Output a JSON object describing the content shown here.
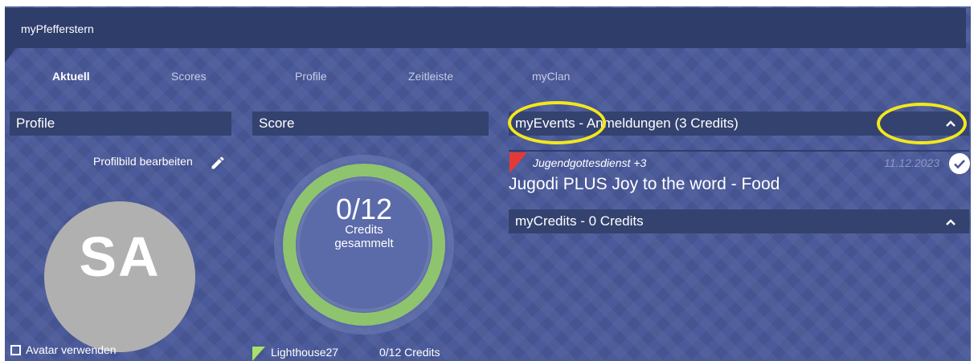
{
  "app": {
    "title": "myPfefferstern"
  },
  "tabs": [
    {
      "label": "Aktuell",
      "active": true
    },
    {
      "label": "Scores"
    },
    {
      "label": "Profile"
    },
    {
      "label": "Zeitleiste"
    },
    {
      "label": "myClan"
    }
  ],
  "profile": {
    "header": "Profile",
    "edit_label": "Profilbild bearbeiten",
    "initials": "SA",
    "avatar_checkbox_label": "Avatar verwenden",
    "avatar_checkbox_checked": false
  },
  "score": {
    "header": "Score",
    "value": "0/12",
    "sub_line1": "Credits",
    "sub_line2": "gesammelt",
    "progress": 0,
    "ring_color": "#8fc46f",
    "legend": {
      "name": "Lighthouse27",
      "credits": "0/12 Credits",
      "color": "#a8e06a"
    }
  },
  "events": {
    "header_prefix": "myEvents - ",
    "header_suffix": " Anmeldungen (3 Credits)",
    "items": [
      {
        "category": "Jugendgottesdienst +3",
        "date": "11.12.2023",
        "title": "Jugodi PLUS Joy to the word - Food",
        "flag_color": "#e53935"
      }
    ]
  },
  "credits": {
    "header": "myCredits - 0 Credits"
  },
  "annotation": {
    "highlight_color": "#f2e81c"
  },
  "icons": [
    "pencil-icon",
    "chevron-up-icon",
    "check-circle-icon",
    "checkbox-icon"
  ]
}
